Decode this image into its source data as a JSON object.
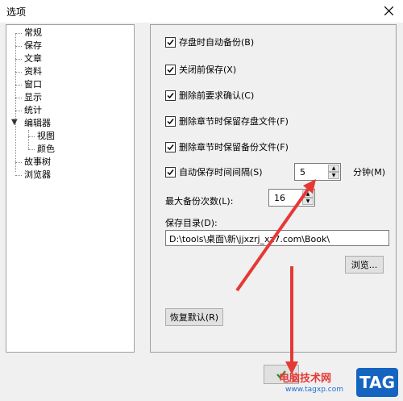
{
  "window": {
    "title": "选项"
  },
  "tree": {
    "items": [
      {
        "label": "常规"
      },
      {
        "label": "保存"
      },
      {
        "label": "文章"
      },
      {
        "label": "资料"
      },
      {
        "label": "窗口"
      },
      {
        "label": "显示"
      },
      {
        "label": "统计"
      },
      {
        "label": "编辑器",
        "expanded": true,
        "children": [
          {
            "label": "视图"
          },
          {
            "label": "颜色"
          }
        ]
      },
      {
        "label": "故事树"
      },
      {
        "label": "浏览器"
      }
    ]
  },
  "options": {
    "auto_backup_on_save": {
      "label": "存盘时自动备份(B)",
      "checked": true
    },
    "save_before_close": {
      "label": "关闭前保存(X)",
      "checked": true
    },
    "confirm_before_delete": {
      "label": "删除前要求确认(C)",
      "checked": true
    },
    "keep_save_file_on_delete_chapter": {
      "label": "删除章节时保留存盘文件(F)",
      "checked": true
    },
    "keep_backup_file_on_delete_chapter": {
      "label": "删除章节时保留备份文件(F)",
      "checked": true
    },
    "auto_save_interval": {
      "label": "自动保存时间间隔(S)",
      "checked": true,
      "value": "5",
      "unit": "分钟(M)"
    },
    "max_backups": {
      "label": "最大备份次数(L):",
      "value": "16"
    },
    "save_dir": {
      "label": "保存目录(D):",
      "value": "D:\\tools\\桌面\\新\\jjxzrj_xz7.com\\Book\\"
    },
    "browse_label": "浏览...",
    "restore_defaults_label": "恢复默认(R)"
  },
  "watermark": {
    "text": "电脑技术网",
    "url": "www.tagxp.com",
    "badge": "TAG"
  },
  "colors": {
    "annotation_red": "#e53935",
    "badge_blue": "#1565c0"
  }
}
